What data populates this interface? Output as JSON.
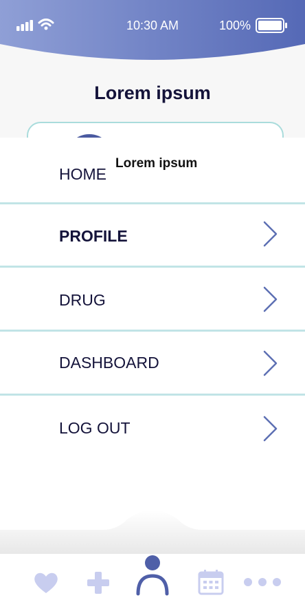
{
  "status_bar": {
    "time": "10:30 AM",
    "battery": "100%"
  },
  "header": {
    "title": "Lorem ipsum"
  },
  "overlay_title": "Lorem ipsum",
  "menu": {
    "items": [
      {
        "label": "HOME",
        "chevron": false,
        "bold": false
      },
      {
        "label": "PROFILE",
        "chevron": true,
        "bold": true
      },
      {
        "label": "DRUG",
        "chevron": true,
        "bold": false
      },
      {
        "label": "DASHBOARD",
        "chevron": true,
        "bold": false
      },
      {
        "label": "LOG OUT",
        "chevron": true,
        "bold": false
      }
    ]
  },
  "tabbar": {
    "icons": [
      "heart-icon",
      "plus-icon",
      "person-icon",
      "calendar-icon",
      "more-icon"
    ],
    "active": "person-icon"
  },
  "colors": {
    "status_bar_gradient": [
      "#8f9fd6",
      "#5569b6"
    ],
    "menu_divider": "#c1e4e6",
    "chevron": "#5d6fb3",
    "text_dark": "#14133a",
    "tab_inactive": "#c8cdef",
    "tab_active": "#4f5fa8"
  }
}
